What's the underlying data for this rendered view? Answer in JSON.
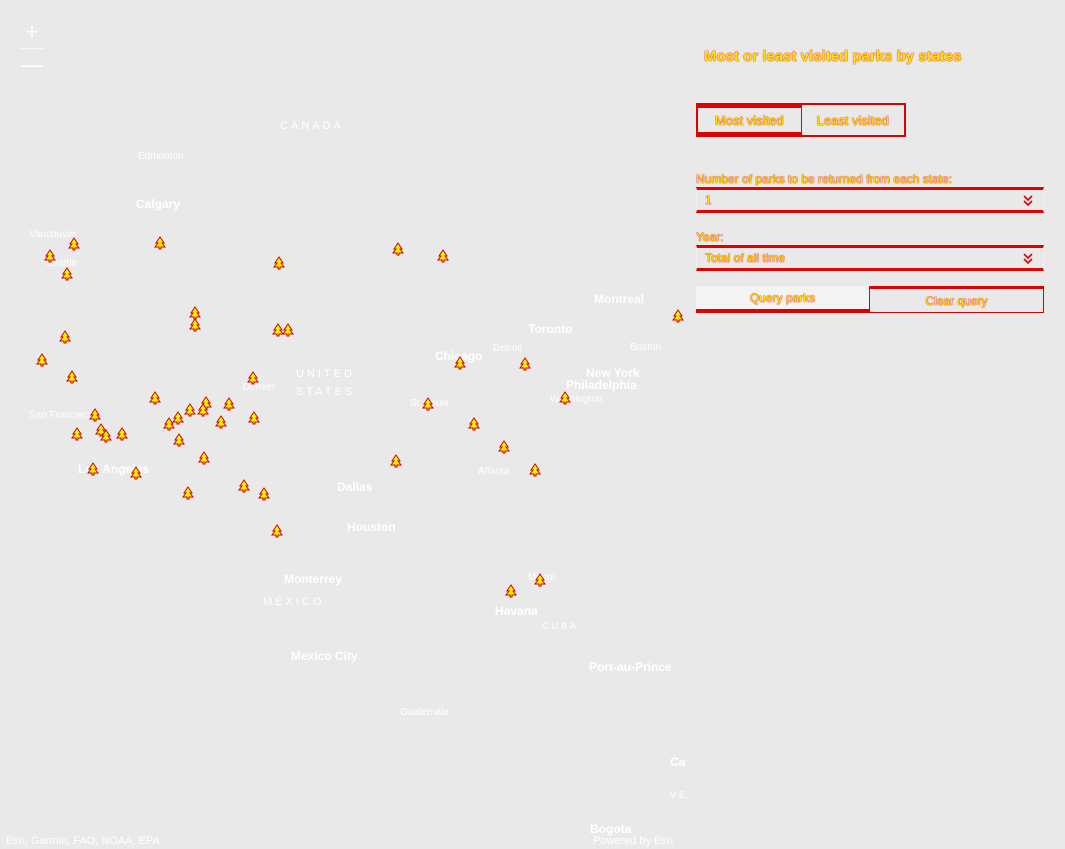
{
  "map": {
    "zoom_in_label": "+",
    "zoom_out_label": "—",
    "labels": {
      "canada": "CANADA",
      "edmonton": "Edmonton",
      "calgary": "Calgary",
      "vancouver": "Vancouver",
      "seattle": "Seattle",
      "united_states_1": "UNITED",
      "united_states_2": "STATES",
      "denver": "Denver",
      "san_francisco": "San Francisco",
      "los_angeles": "Los Angeles",
      "dallas": "Dallas",
      "houston": "Houston",
      "chicago": "Chicago",
      "detroit": "Detroit",
      "toronto": "Toronto",
      "montreal": "Montreal",
      "boston": "Boston",
      "new_york": "New York",
      "philadelphia": "Philadelphia",
      "washington": "Washington",
      "st_louis": "St. Louis",
      "atlanta": "Atlanta",
      "miami": "Miami",
      "havana": "Havana",
      "cuba": "CUBA",
      "monterrey": "Monterrey",
      "mexico": "MÉXICO",
      "mexico_city": "Mexico City",
      "guatemala": "Guatemala",
      "port_au_prince": "Port-au-Prince",
      "ca_partial": "Ca",
      "ve_partial": "VE",
      "bogota": "Bogota"
    },
    "attribution": "Esri, Garmin, FAO, NOAA, EPA",
    "powered_by": "Powered by Esri",
    "park_icon": "tree-icon"
  },
  "panel": {
    "title": "Most or least visited parks by states",
    "mode_options": [
      "Most visited",
      "Least visited"
    ],
    "selected_mode": "Most visited",
    "count_label": "Number of parks to be returned from each state:",
    "count_value": "1",
    "year_label": "Year:",
    "year_value": "Total of all time",
    "query_button": "Query parks",
    "clear_button": "Clear query"
  },
  "colors": {
    "map_background": "#e9e9e9",
    "label_text": "#ffffff",
    "highlight_text": "#ffe600",
    "outline": "#e00000"
  }
}
